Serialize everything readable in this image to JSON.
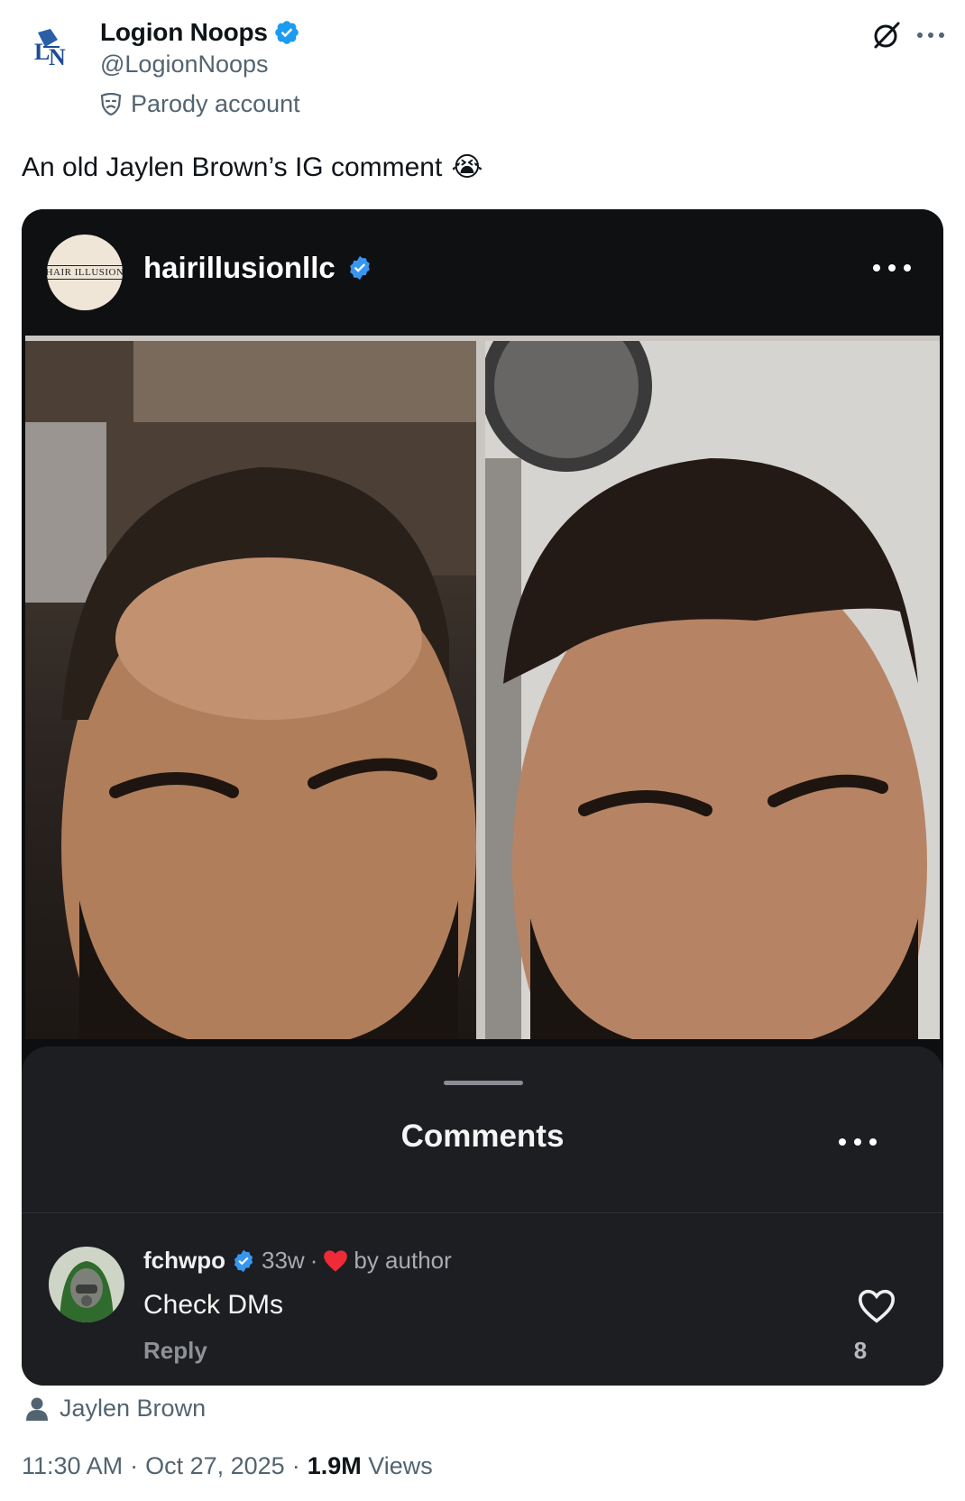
{
  "author": {
    "display_name": "Logion Noops",
    "handle": "@LogionNoops",
    "label": "Parody account"
  },
  "tweet": {
    "text": "An old Jaylen Brown’s IG comment",
    "emoji": "😭"
  },
  "ig_post": {
    "username": "hairillusionllc",
    "avatar_text": "HAIR ILLUSION",
    "comments_title": "Comments",
    "comment": {
      "username": "fchwpo",
      "age": "33w",
      "separator": "·",
      "author_like": "by author",
      "text": "Check DMs",
      "reply_label": "Reply",
      "like_count": "8"
    }
  },
  "tagged_user": "Jaylen Brown",
  "footer": {
    "time": "11:30 AM",
    "sep1": "·",
    "date": "Oct 27, 2025",
    "sep2": "·",
    "views_count": "1.9M",
    "views_label": "Views"
  },
  "colors": {
    "verified_blue": "#1d9bf0",
    "secondary_text": "#536471",
    "ig_dark": "#0f1012",
    "heart_red": "#ef2b37"
  }
}
